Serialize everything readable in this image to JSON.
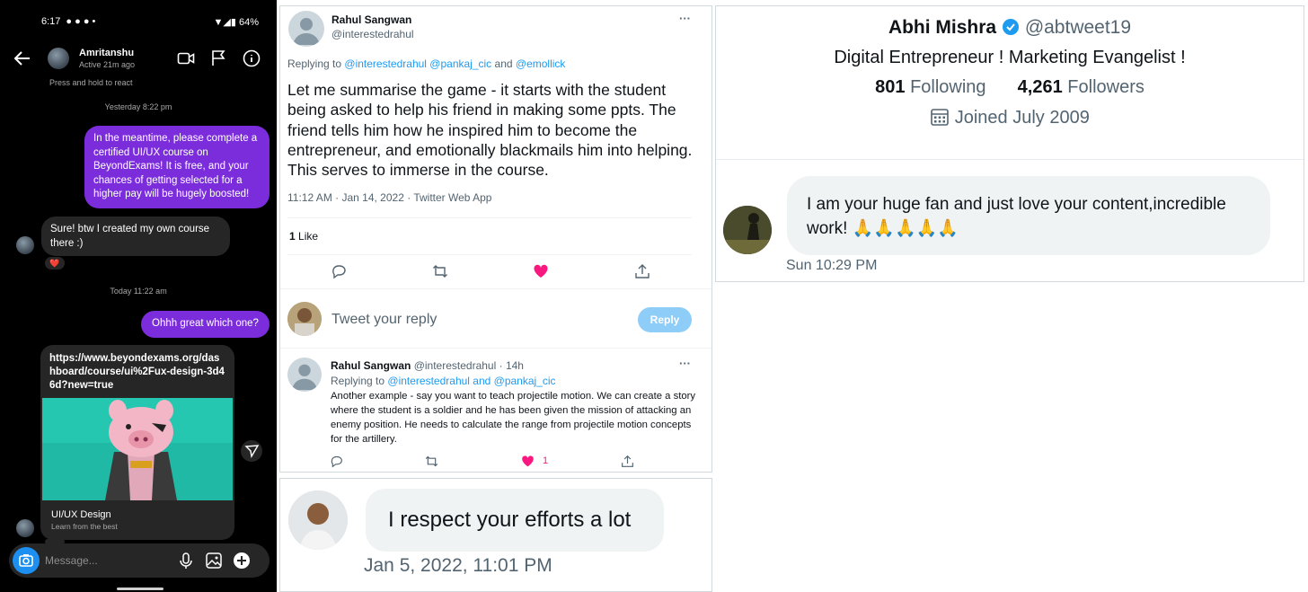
{
  "instagram": {
    "status": {
      "time": "6:17",
      "battery": "64%"
    },
    "contact": {
      "name": "Amritanshu",
      "active": "Active 21m ago"
    },
    "hint": "Press and hold to react",
    "timestamps": [
      "Yesterday 8:22 pm",
      "Today 11:22 am"
    ],
    "messages": [
      {
        "from": "me",
        "text": "In the meantime, please complete a certified UI/UX course on BeyondExams! It is free, and your chances of getting selected for a higher pay will be hugely boosted!"
      },
      {
        "from": "them",
        "text": "Sure! btw I created my own course there :)",
        "reaction": "❤️"
      },
      {
        "from": "me",
        "text": "Ohhh great which one?"
      }
    ],
    "link_card": {
      "url": "https://www.beyondexams.org/dashboard/course/ui%2Fux-design-3d46d?new=true",
      "title": "UI/UX Design",
      "subtitle": "Learn from the best"
    },
    "composer": {
      "placeholder": "Message..."
    },
    "icons": [
      "back-arrow-icon",
      "video-call-icon",
      "flag-icon",
      "info-icon",
      "camera-icon",
      "microphone-icon",
      "gallery-icon",
      "plus-icon",
      "share-icon"
    ]
  },
  "tweet": {
    "author_name": "Rahul Sangwan",
    "author_handle": "@interestedrahul",
    "replying_prefix": "Replying to",
    "replying_to": "@interestedrahul @pankaj_cic",
    "replying_and": "and",
    "replying_last": "@emollick",
    "text": "Let me summarise the game - it starts with the student being asked to help his friend in making some ppts. The friend tells him how he inspired him to become the entrepreneur, and emotionally blackmails him into helping. This serves to immerse in the course.",
    "meta": "11:12 AM · Jan 14, 2022 · Twitter Web App",
    "likes_count": "1",
    "likes_label": "Like",
    "reply_placeholder": "Tweet your reply",
    "reply_button": "Reply",
    "more": "···",
    "reply2": {
      "author_name": "Rahul Sangwan",
      "author_handle": "@interestedrahul",
      "age": "14h",
      "replying_prefix": "Replying to",
      "replying_to": "@interestedrahul and @pankaj_cic",
      "text": "Another example - say you want to teach projectile motion. We can create a story where the student is a soldier and he has been given the mission of attacking an enemy position. He needs to calculate the range from projectile motion concepts for the artillery.",
      "like_count": "1"
    }
  },
  "respect": {
    "message": "I respect your efforts a lot",
    "time": "Jan 5, 2022, 11:01 PM"
  },
  "profile": {
    "name": "Abhi Mishra",
    "handle": "@abtweet19",
    "bio": "Digital Entrepreneur ! Marketing Evangelist !",
    "following_count": "801",
    "following_label": "Following",
    "followers_count": "4,261",
    "followers_label": "Followers",
    "joined": "Joined July 2009",
    "dm_text": "I am your huge fan and just love your content,incredible work! 🙏🙏🙏🙏🙏",
    "dm_time": "Sun 10:29 PM"
  },
  "colors": {
    "instagram_purple": "#7b2ddb",
    "twitter_blue": "#1d9bf0",
    "like_pink": "#f91880"
  }
}
